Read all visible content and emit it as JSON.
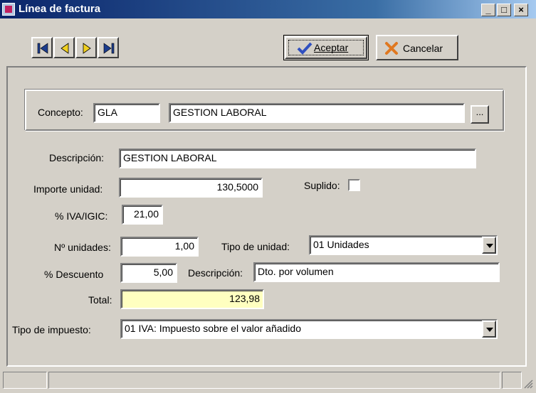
{
  "window": {
    "title": "Línea de factura",
    "minimize": "_",
    "maximize": "□",
    "close": "×"
  },
  "toolbar": {
    "accept_label": "Aceptar",
    "cancel_label": "Cancelar"
  },
  "concepto": {
    "label": "Concepto:",
    "code": "GLA",
    "name": "GESTION LABORAL",
    "browse_label": "..."
  },
  "form": {
    "descripcion_label": "Descripción:",
    "descripcion_value": "GESTION LABORAL",
    "importe_label": "Importe unidad:",
    "importe_value": "130,5000",
    "suplido_label": "Suplido:",
    "iva_label": "% IVA/IGIC:",
    "iva_value": "21,00",
    "unidades_label": "Nº unidades:",
    "unidades_value": "1,00",
    "tipo_unidad_label": "Tipo de unidad:",
    "tipo_unidad_value": "01 Unidades",
    "descuento_label": "% Descuento",
    "descuento_value": "5,00",
    "desc_descuento_label": "Descripción:",
    "desc_descuento_value": "Dto. por volumen",
    "total_label": "Total:",
    "total_value": "123,98",
    "tipo_impuesto_label": "Tipo de impuesto:",
    "tipo_impuesto_value": "01 IVA: Impuesto sobre el valor añadido"
  },
  "colors": {
    "total_bg": "#ffffc0",
    "accent": "#0a246a"
  }
}
